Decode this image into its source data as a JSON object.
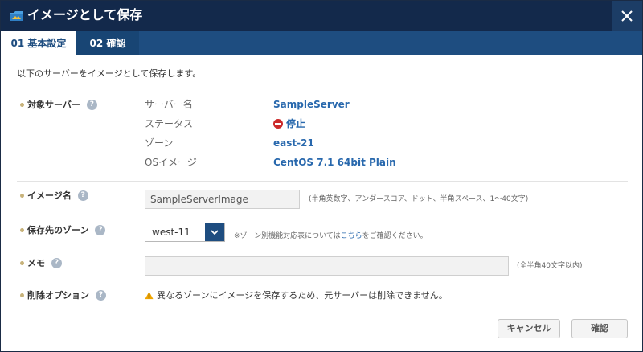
{
  "dialog": {
    "title": "イメージとして保存",
    "icon": "image-folder-icon",
    "close_icon": "close-icon"
  },
  "tabs": [
    {
      "label": "01 基本設定",
      "active": true
    },
    {
      "label": "02 確認",
      "active": false
    }
  ],
  "intro": "以下のサーバーをイメージとして保存します。",
  "target_server": {
    "label": "対象サーバー",
    "help": "?",
    "fields": [
      {
        "key": "サーバー名",
        "value": "SampleServer"
      },
      {
        "key": "ステータス",
        "value": "停止",
        "status_icon": "stop-icon"
      },
      {
        "key": "ゾーン",
        "value": "east-21"
      },
      {
        "key": "OSイメージ",
        "value": "CentOS 7.1 64bit Plain"
      }
    ]
  },
  "image_name": {
    "label": "イメージ名",
    "help": "?",
    "value": "SampleServerImage",
    "hint": "(半角英数字、アンダースコア、ドット、半角スペース、1～40文字)"
  },
  "dest_zone": {
    "label": "保存先のゾーン",
    "help": "?",
    "selected": "west-11",
    "note_prefix": "※ゾーン別機能対応表については",
    "note_link": "こちら",
    "note_suffix": "をご確認ください。"
  },
  "memo": {
    "label": "メモ",
    "help": "?",
    "value": "",
    "hint": "(全半角40文字以内)"
  },
  "delete_option": {
    "label": "削除オプション",
    "help": "?",
    "warning": "異なるゾーンにイメージを保存するため、元サーバーは削除できません。",
    "warning_icon": "warning-icon"
  },
  "buttons": {
    "cancel": "キャンセル",
    "confirm": "確認"
  },
  "colors": {
    "header": "#13294b",
    "tab_bar": "#1e4d80",
    "link": "#2868ad",
    "stop": "#cc2a2a",
    "warning": "#f0a500"
  }
}
